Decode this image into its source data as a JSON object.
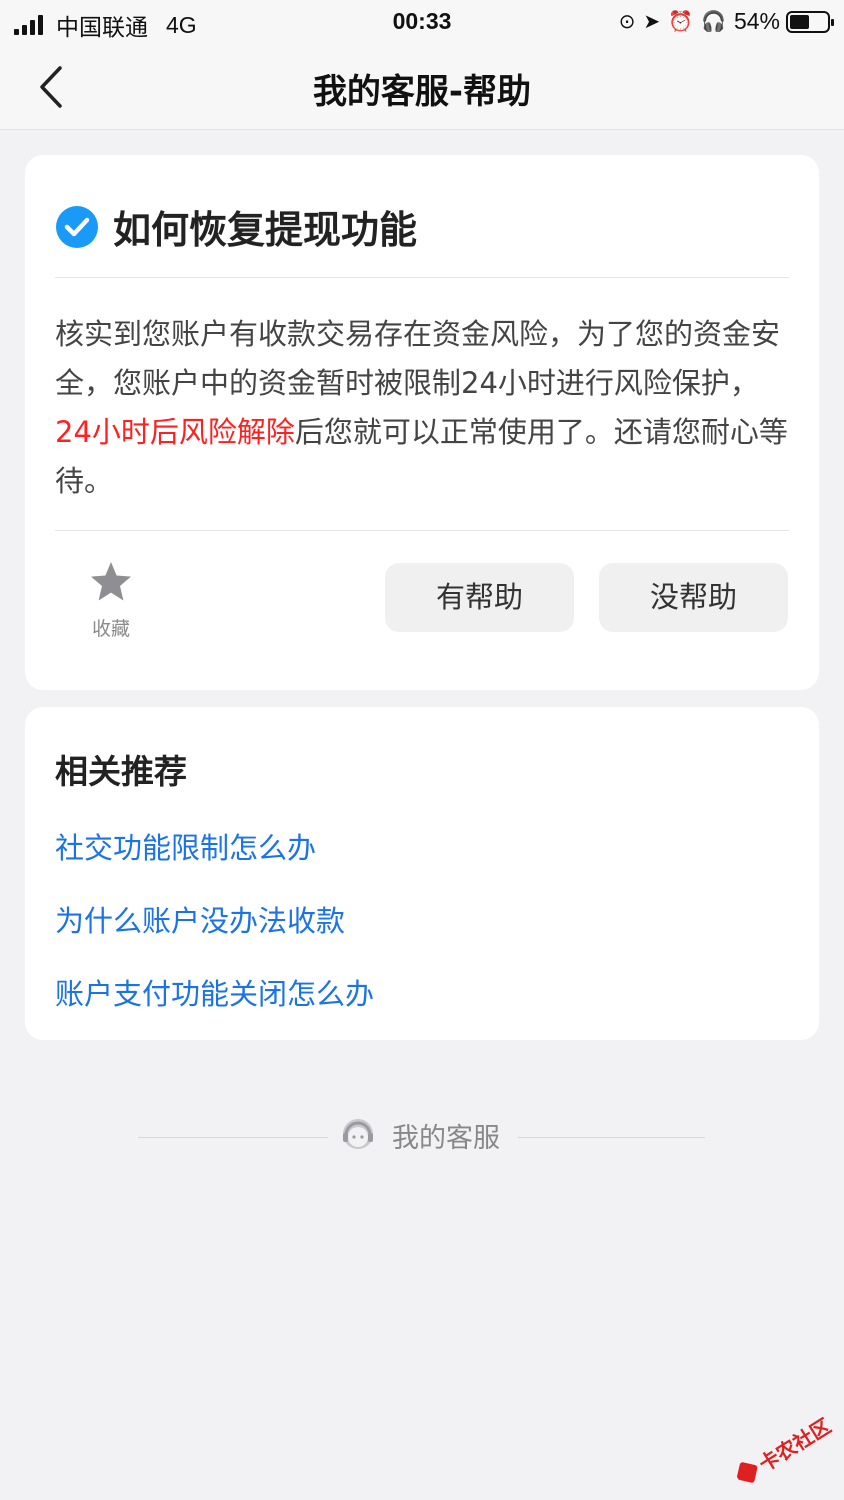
{
  "status_bar": {
    "carrier": "中国联通",
    "network": "4G",
    "time": "00:33",
    "battery": "54%",
    "battery_level": 0.54
  },
  "nav": {
    "title": "我的客服-帮助"
  },
  "question": {
    "title": "如何恢复提现功能",
    "answer_before": "核实到您账户有收款交易存在资金风险，为了您的资金安全，您账户中的资金暂时被限制24小时进行风险保护，",
    "answer_highlight": "24小时后风险解除",
    "answer_after": "后您就可以正常使用了。还请您耐心等待。",
    "highlight_color": "#ff2020"
  },
  "actions": {
    "favorite_label": "收藏",
    "helpful_label": "有帮助",
    "not_helpful_label": "没帮助"
  },
  "related": {
    "title": "相关推荐",
    "items": [
      "社交功能限制怎么办",
      "为什么账户没办法收款",
      "账户支付功能关闭怎么办"
    ],
    "link_color": "#1a73e8"
  },
  "footer": {
    "label": "我的客服"
  },
  "watermark": {
    "text": "卡农社区"
  },
  "colors": {
    "accent": "#1a9af7",
    "background": "#f2f2f5"
  }
}
